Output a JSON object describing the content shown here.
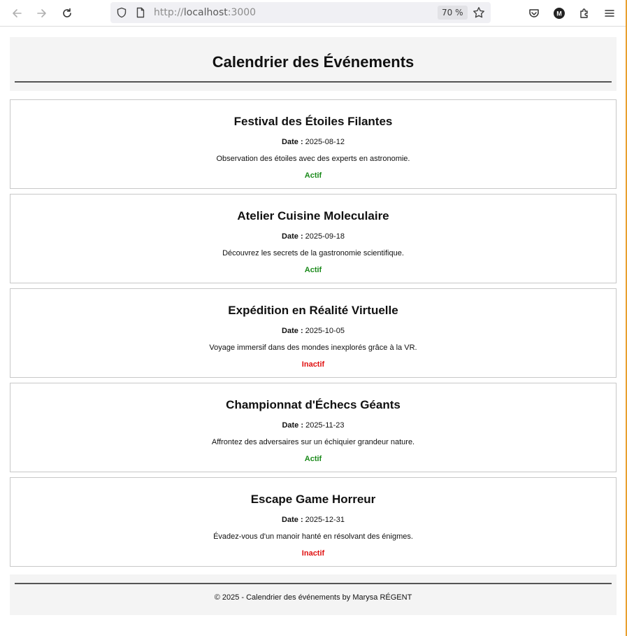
{
  "browser": {
    "url_scheme": "http://",
    "url_host": "localhost",
    "url_port": ":3000",
    "zoom": "70 %"
  },
  "header": {
    "title": "Calendrier des Événements"
  },
  "date_label": "Date :",
  "events": [
    {
      "title": "Festival des Étoiles Filantes",
      "date": "2025-08-12",
      "description": "Observation des étoiles avec des experts en astronomie.",
      "status": "Actif"
    },
    {
      "title": "Atelier Cuisine Moleculaire",
      "date": "2025-09-18",
      "description": "Découvrez les secrets de la gastronomie scientifique.",
      "status": "Actif"
    },
    {
      "title": "Expédition en Réalité Virtuelle",
      "date": "2025-10-05",
      "description": "Voyage immersif dans des mondes inexplorés grâce à la VR.",
      "status": "Inactif"
    },
    {
      "title": "Championnat d'Échecs Géants",
      "date": "2025-11-23",
      "description": "Affrontez des adversaires sur un échiquier grandeur nature.",
      "status": "Actif"
    },
    {
      "title": "Escape Game Horreur",
      "date": "2025-12-31",
      "description": "Évadez-vous d'un manoir hanté en résolvant des énigmes.",
      "status": "Inactif"
    }
  ],
  "footer": {
    "text": "© 2025 - Calendrier des événements by Marysa RÉGENT"
  },
  "colors": {
    "active": "#1a8a1a",
    "inactive": "#e01010"
  }
}
